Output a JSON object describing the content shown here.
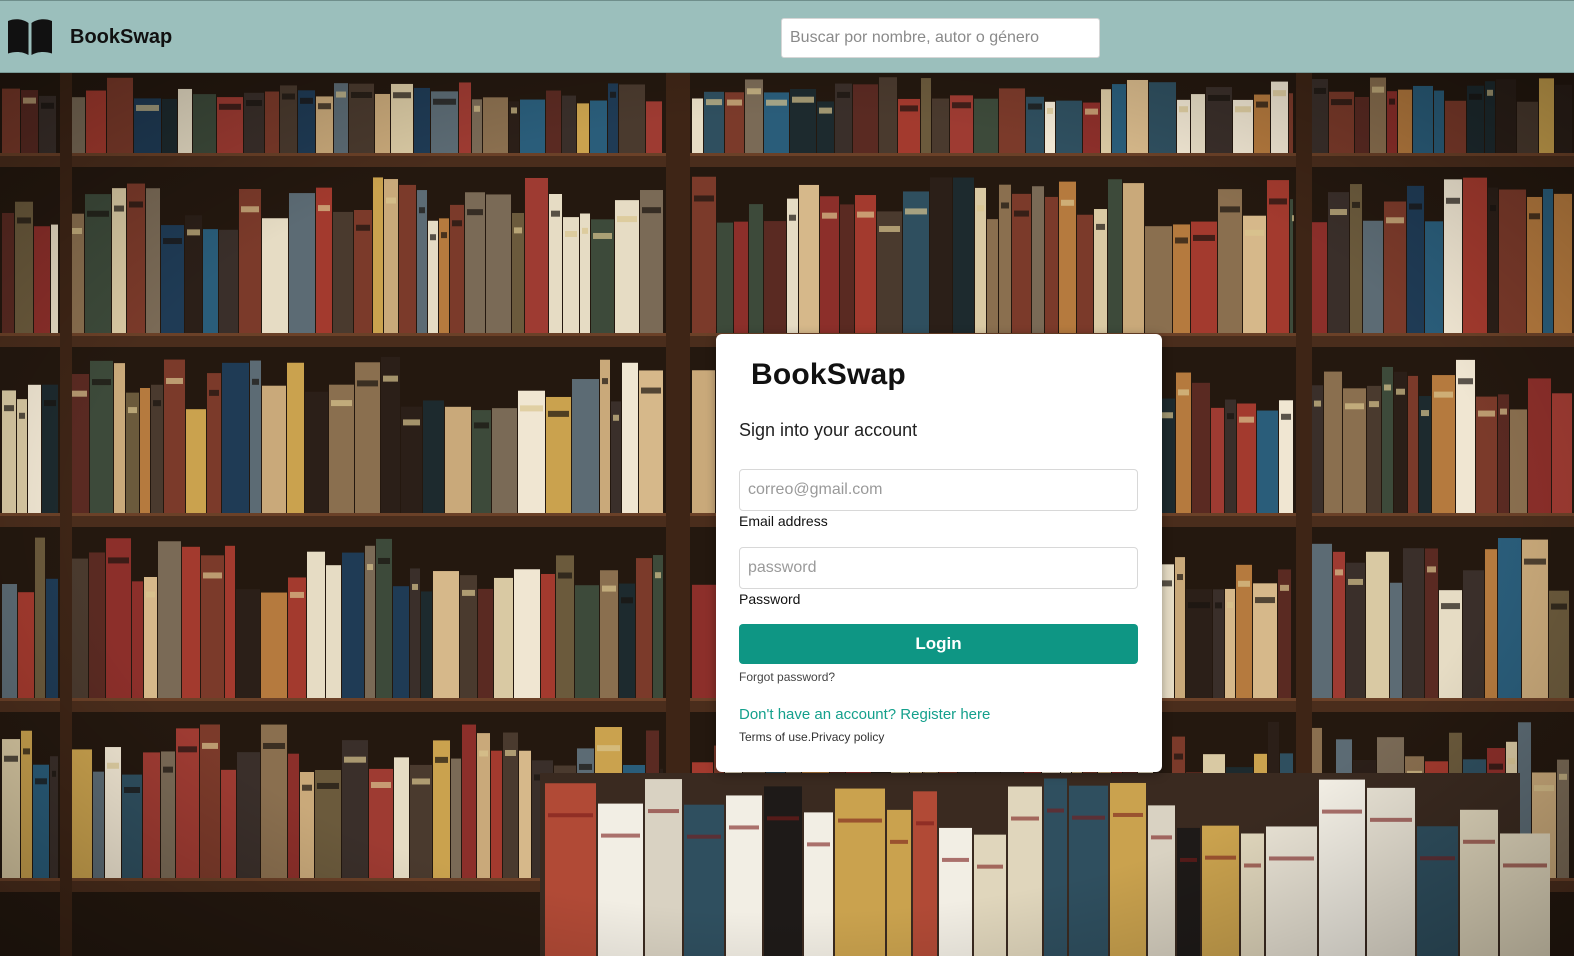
{
  "header": {
    "brand_name": "BookSwap",
    "brand_icon": "open-book-icon",
    "search_placeholder": "Buscar por nombre, autor o género"
  },
  "login": {
    "title": "BookSwap",
    "subtitle": "Sign into your account",
    "email_placeholder": "correo@gmail.com",
    "email_label": "Email address",
    "password_placeholder": "password",
    "password_label": "Password",
    "login_button": "Login",
    "forgot_password": "Forgot password?",
    "register_link": "Don't have an account? Register here",
    "terms": "Terms of use.",
    "privacy": "Privacy policy"
  },
  "colors": {
    "navbar": "#9bbfbc",
    "accent": "#0e9684",
    "link": "#14a08c"
  }
}
